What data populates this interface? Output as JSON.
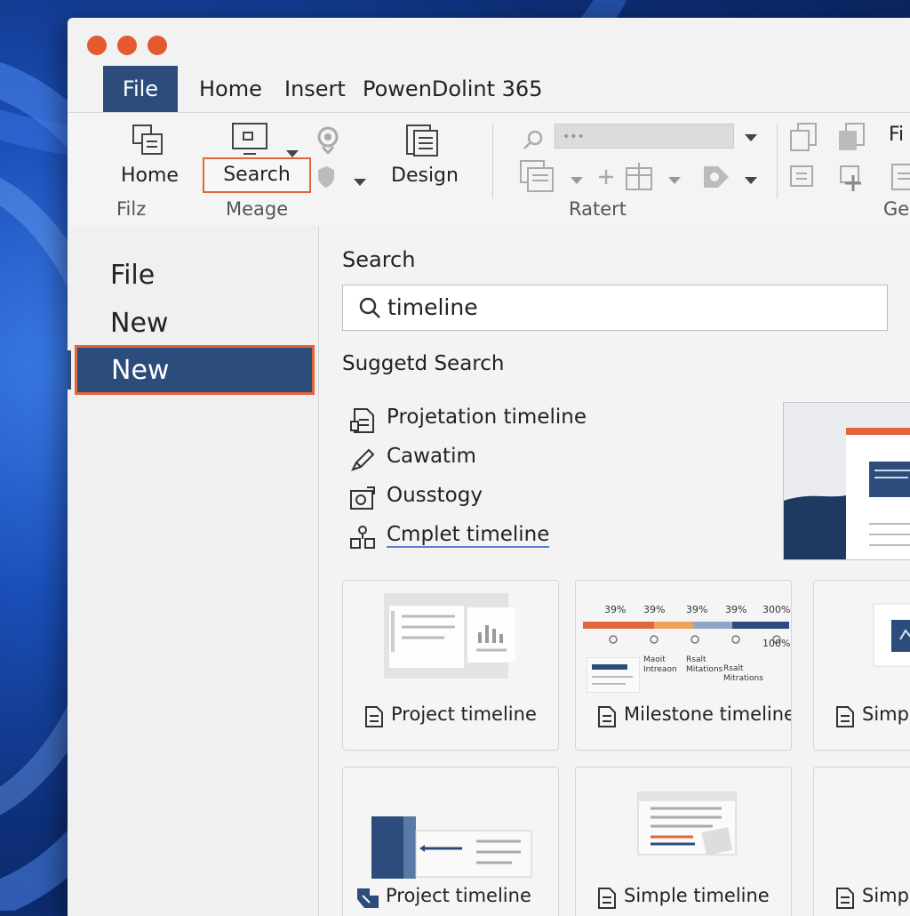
{
  "menu": {
    "file": "File",
    "home": "Home",
    "insert": "Insert",
    "app_name": "PowenDolint 365"
  },
  "ribbon": {
    "home_label": "Home",
    "search_label": "Search",
    "design_label": "Design",
    "partial_label": "Fi",
    "groups": [
      "Filz",
      "Meage",
      "Ratert",
      "Ge"
    ],
    "field_text": "•••"
  },
  "nav": {
    "items": [
      "File",
      "New"
    ],
    "selected": "New"
  },
  "main": {
    "title": "Search",
    "search_value": "timeline",
    "suggested_title": "Suggetd Search",
    "suggestions": [
      "Projetation timeline",
      "Cawatim",
      "Ousstogy",
      "Cmplet timeline"
    ],
    "cards": [
      "Project timeline",
      "Milestone timeline",
      "Simple",
      "Project timeline",
      "Simple timeline",
      "Simpl"
    ],
    "milestone_percents": [
      "39%",
      "39%",
      "39%",
      "39%",
      "300%"
    ],
    "milestone_bottom": "100%",
    "milestone_notes": [
      "Maoit\nIntreaon",
      "Rsalt\nMitations",
      "Rsalt\nMitrations"
    ]
  },
  "colors": {
    "accent": "#e2663a",
    "brand": "#2c4d7c",
    "window_bg": "#f2f2f2"
  }
}
